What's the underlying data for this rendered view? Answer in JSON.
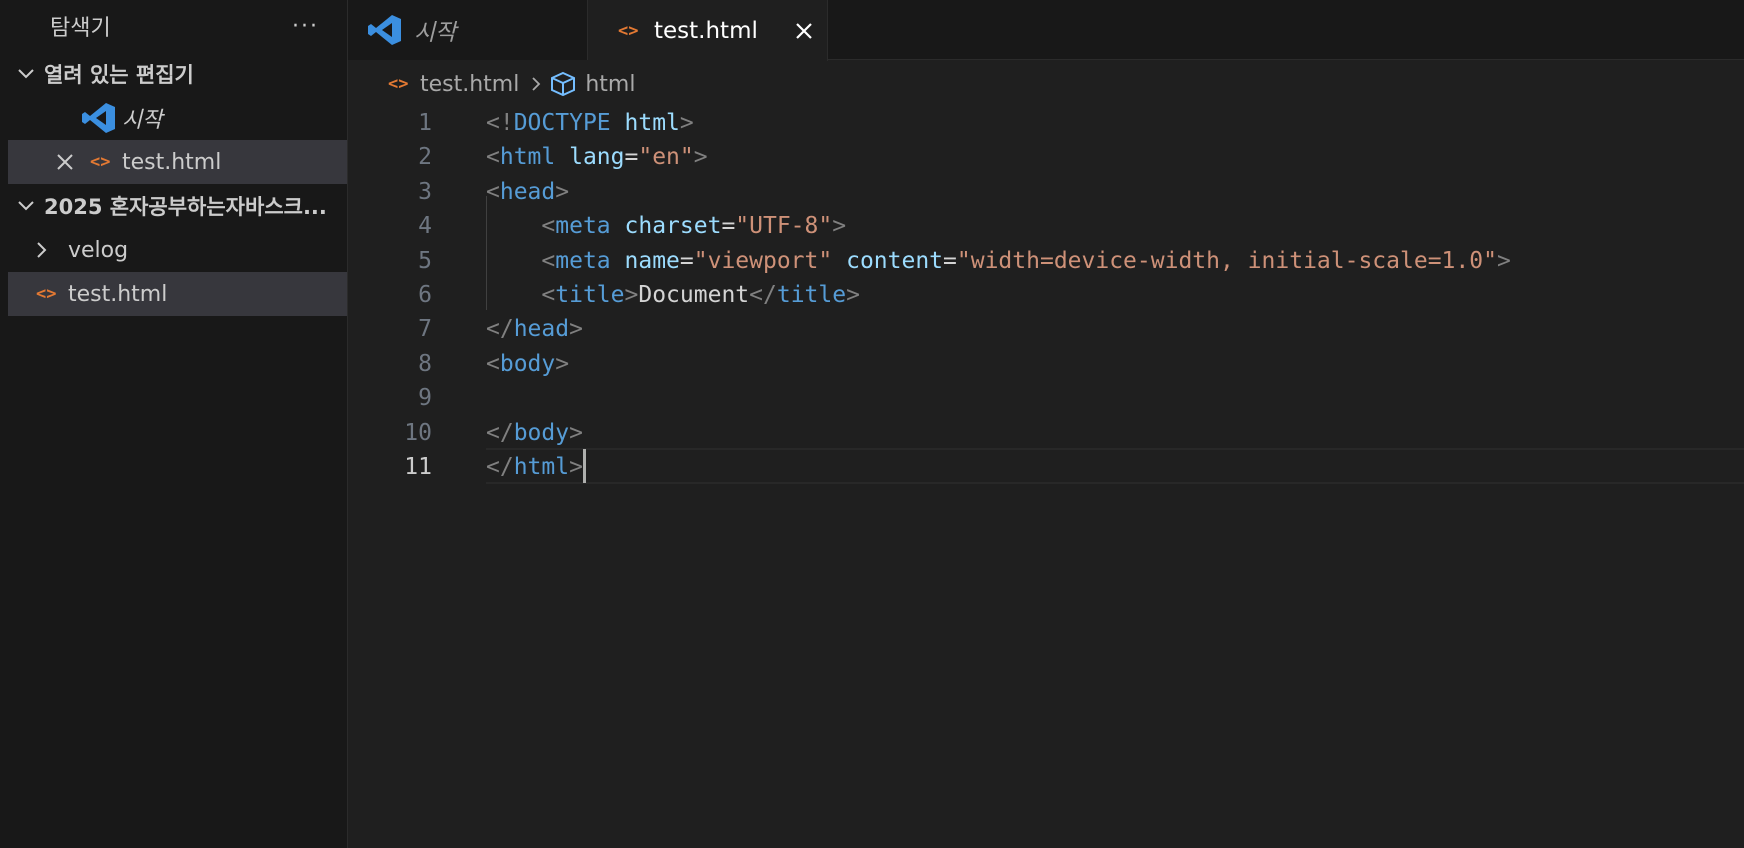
{
  "sidebar": {
    "title": "탐색기",
    "more_label": "···",
    "open_editors": {
      "label": "열려 있는 편집기",
      "items": [
        {
          "label": "시작",
          "icon": "vscode-logo-icon"
        },
        {
          "label": "test.html",
          "icon": "html-file-icon"
        }
      ]
    },
    "workspace": {
      "label": "2025 혼자공부하는자바스크...",
      "items": [
        {
          "label": "velog",
          "type": "folder"
        },
        {
          "label": "test.html",
          "type": "file"
        }
      ]
    }
  },
  "tabs": [
    {
      "label": "시작",
      "active": false
    },
    {
      "label": "test.html",
      "active": true
    }
  ],
  "breadcrumb": {
    "file": "test.html",
    "symbol": "html"
  },
  "editor": {
    "current_line": 11,
    "line_numbers": [
      "1",
      "2",
      "3",
      "4",
      "5",
      "6",
      "7",
      "8",
      "9",
      "10",
      "11"
    ],
    "lines": [
      [
        [
          "punc",
          "<!"
        ],
        [
          "tag",
          "DOCTYPE"
        ],
        [
          "text",
          " "
        ],
        [
          "attr",
          "html"
        ],
        [
          "punc",
          ">"
        ]
      ],
      [
        [
          "punc",
          "<"
        ],
        [
          "tag",
          "html"
        ],
        [
          "text",
          " "
        ],
        [
          "attr",
          "lang"
        ],
        [
          "eq",
          "="
        ],
        [
          "str",
          "\"en\""
        ],
        [
          "punc",
          ">"
        ]
      ],
      [
        [
          "punc",
          "<"
        ],
        [
          "tag",
          "head"
        ],
        [
          "punc",
          ">"
        ]
      ],
      [
        [
          "text",
          "    "
        ],
        [
          "punc",
          "<"
        ],
        [
          "tag",
          "meta"
        ],
        [
          "text",
          " "
        ],
        [
          "attr",
          "charset"
        ],
        [
          "eq",
          "="
        ],
        [
          "str",
          "\"UTF-8\""
        ],
        [
          "punc",
          ">"
        ]
      ],
      [
        [
          "text",
          "    "
        ],
        [
          "punc",
          "<"
        ],
        [
          "tag",
          "meta"
        ],
        [
          "text",
          " "
        ],
        [
          "attr",
          "name"
        ],
        [
          "eq",
          "="
        ],
        [
          "str",
          "\"viewport\""
        ],
        [
          "text",
          " "
        ],
        [
          "attr",
          "content"
        ],
        [
          "eq",
          "="
        ],
        [
          "str",
          "\"width=device-width, initial-scale=1.0\""
        ],
        [
          "punc",
          ">"
        ]
      ],
      [
        [
          "text",
          "    "
        ],
        [
          "punc",
          "<"
        ],
        [
          "tag",
          "title"
        ],
        [
          "punc",
          ">"
        ],
        [
          "text",
          "Document"
        ],
        [
          "punc",
          "</"
        ],
        [
          "tag",
          "title"
        ],
        [
          "punc",
          ">"
        ]
      ],
      [
        [
          "punc",
          "</"
        ],
        [
          "tag",
          "head"
        ],
        [
          "punc",
          ">"
        ]
      ],
      [
        [
          "punc",
          "<"
        ],
        [
          "tag",
          "body"
        ],
        [
          "punc",
          ">"
        ]
      ],
      [],
      [
        [
          "punc",
          "</"
        ],
        [
          "tag",
          "body"
        ],
        [
          "punc",
          ">"
        ]
      ],
      [
        [
          "punc",
          "</"
        ],
        [
          "tag",
          "html"
        ],
        [
          "punc",
          ">"
        ]
      ]
    ]
  },
  "colors": {
    "background": "#1f1f1f",
    "sidebar": "#181818",
    "selection": "#37373d",
    "html_icon": "#e37933",
    "vscode_blue": "#3b8fe0"
  }
}
